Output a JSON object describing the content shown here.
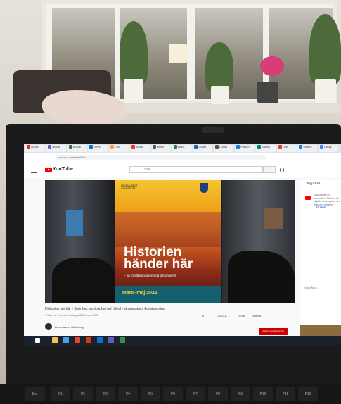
{
  "browser": {
    "tabs": [
      {
        "label": "Gmail",
        "color": "#d93025"
      },
      {
        "label": "Teams",
        "color": "#5b5fc7"
      },
      {
        "label": "Arrival",
        "color": "#2e7d32"
      },
      {
        "label": "Dever",
        "color": "#0078d4"
      },
      {
        "label": "Enn",
        "color": "#f9a825"
      },
      {
        "label": "Yodan",
        "color": "#e53935"
      },
      {
        "label": "Intern",
        "color": "#455a64"
      },
      {
        "label": "Biblio",
        "color": "#2e7d32"
      },
      {
        "label": "Dover",
        "color": "#1565c0"
      },
      {
        "label": "Lunds",
        "color": "#6d4c41"
      },
      {
        "label": "Presen",
        "color": "#1877f2"
      },
      {
        "label": "Samlin",
        "color": "#00897b"
      },
      {
        "label": "Flyer",
        "color": "#e53935"
      },
      {
        "label": "Widow",
        "color": "#1877f2"
      },
      {
        "label": "Detalj",
        "color": "#4285f4"
      }
    ],
    "url": "youtube.com/watch?v=..."
  },
  "youtube": {
    "logo_text": "YouTube",
    "search_placeholder": "Sök"
  },
  "video": {
    "poster": {
      "org": "LÄNSMUSEET GÄVLEBORG",
      "title_line1": "Historien",
      "title_line2": "händer här",
      "subtitle": "– en föreläsningsserie på länsmuseet",
      "dates": "Mars–maj 2022"
    },
    "title": "Historien här här - Skönhet, skröplighet och ideal i länsmuseets konstsamling",
    "meta": "7 tittar nu · Har schemalagts till 29 mars 2022",
    "actions": {
      "like": "0",
      "dislike": "OGILLA",
      "share": "DELA",
      "save": "SPARA"
    },
    "channel": "Länsmuseet Gävleborg",
    "subscribe": "PRENUMERERA"
  },
  "sidebar": {
    "heading": "Toppchatt",
    "notice": "Välkommen till livechatten! Tänk på att skydda din integritet och följa våra riktlinjer.",
    "more": "LÄS MER",
    "chat_placeholder": "Säg något..."
  },
  "keyboard": {
    "esc": "Esc",
    "keys": [
      "F1",
      "F2",
      "F3",
      "F4",
      "F5",
      "F6",
      "F7",
      "F8",
      "F9",
      "F10",
      "F11",
      "F12"
    ]
  },
  "colors": {
    "youtube_red": "#ff0000",
    "poster_teal": "#14606e",
    "poster_orange": "#e78a23"
  }
}
